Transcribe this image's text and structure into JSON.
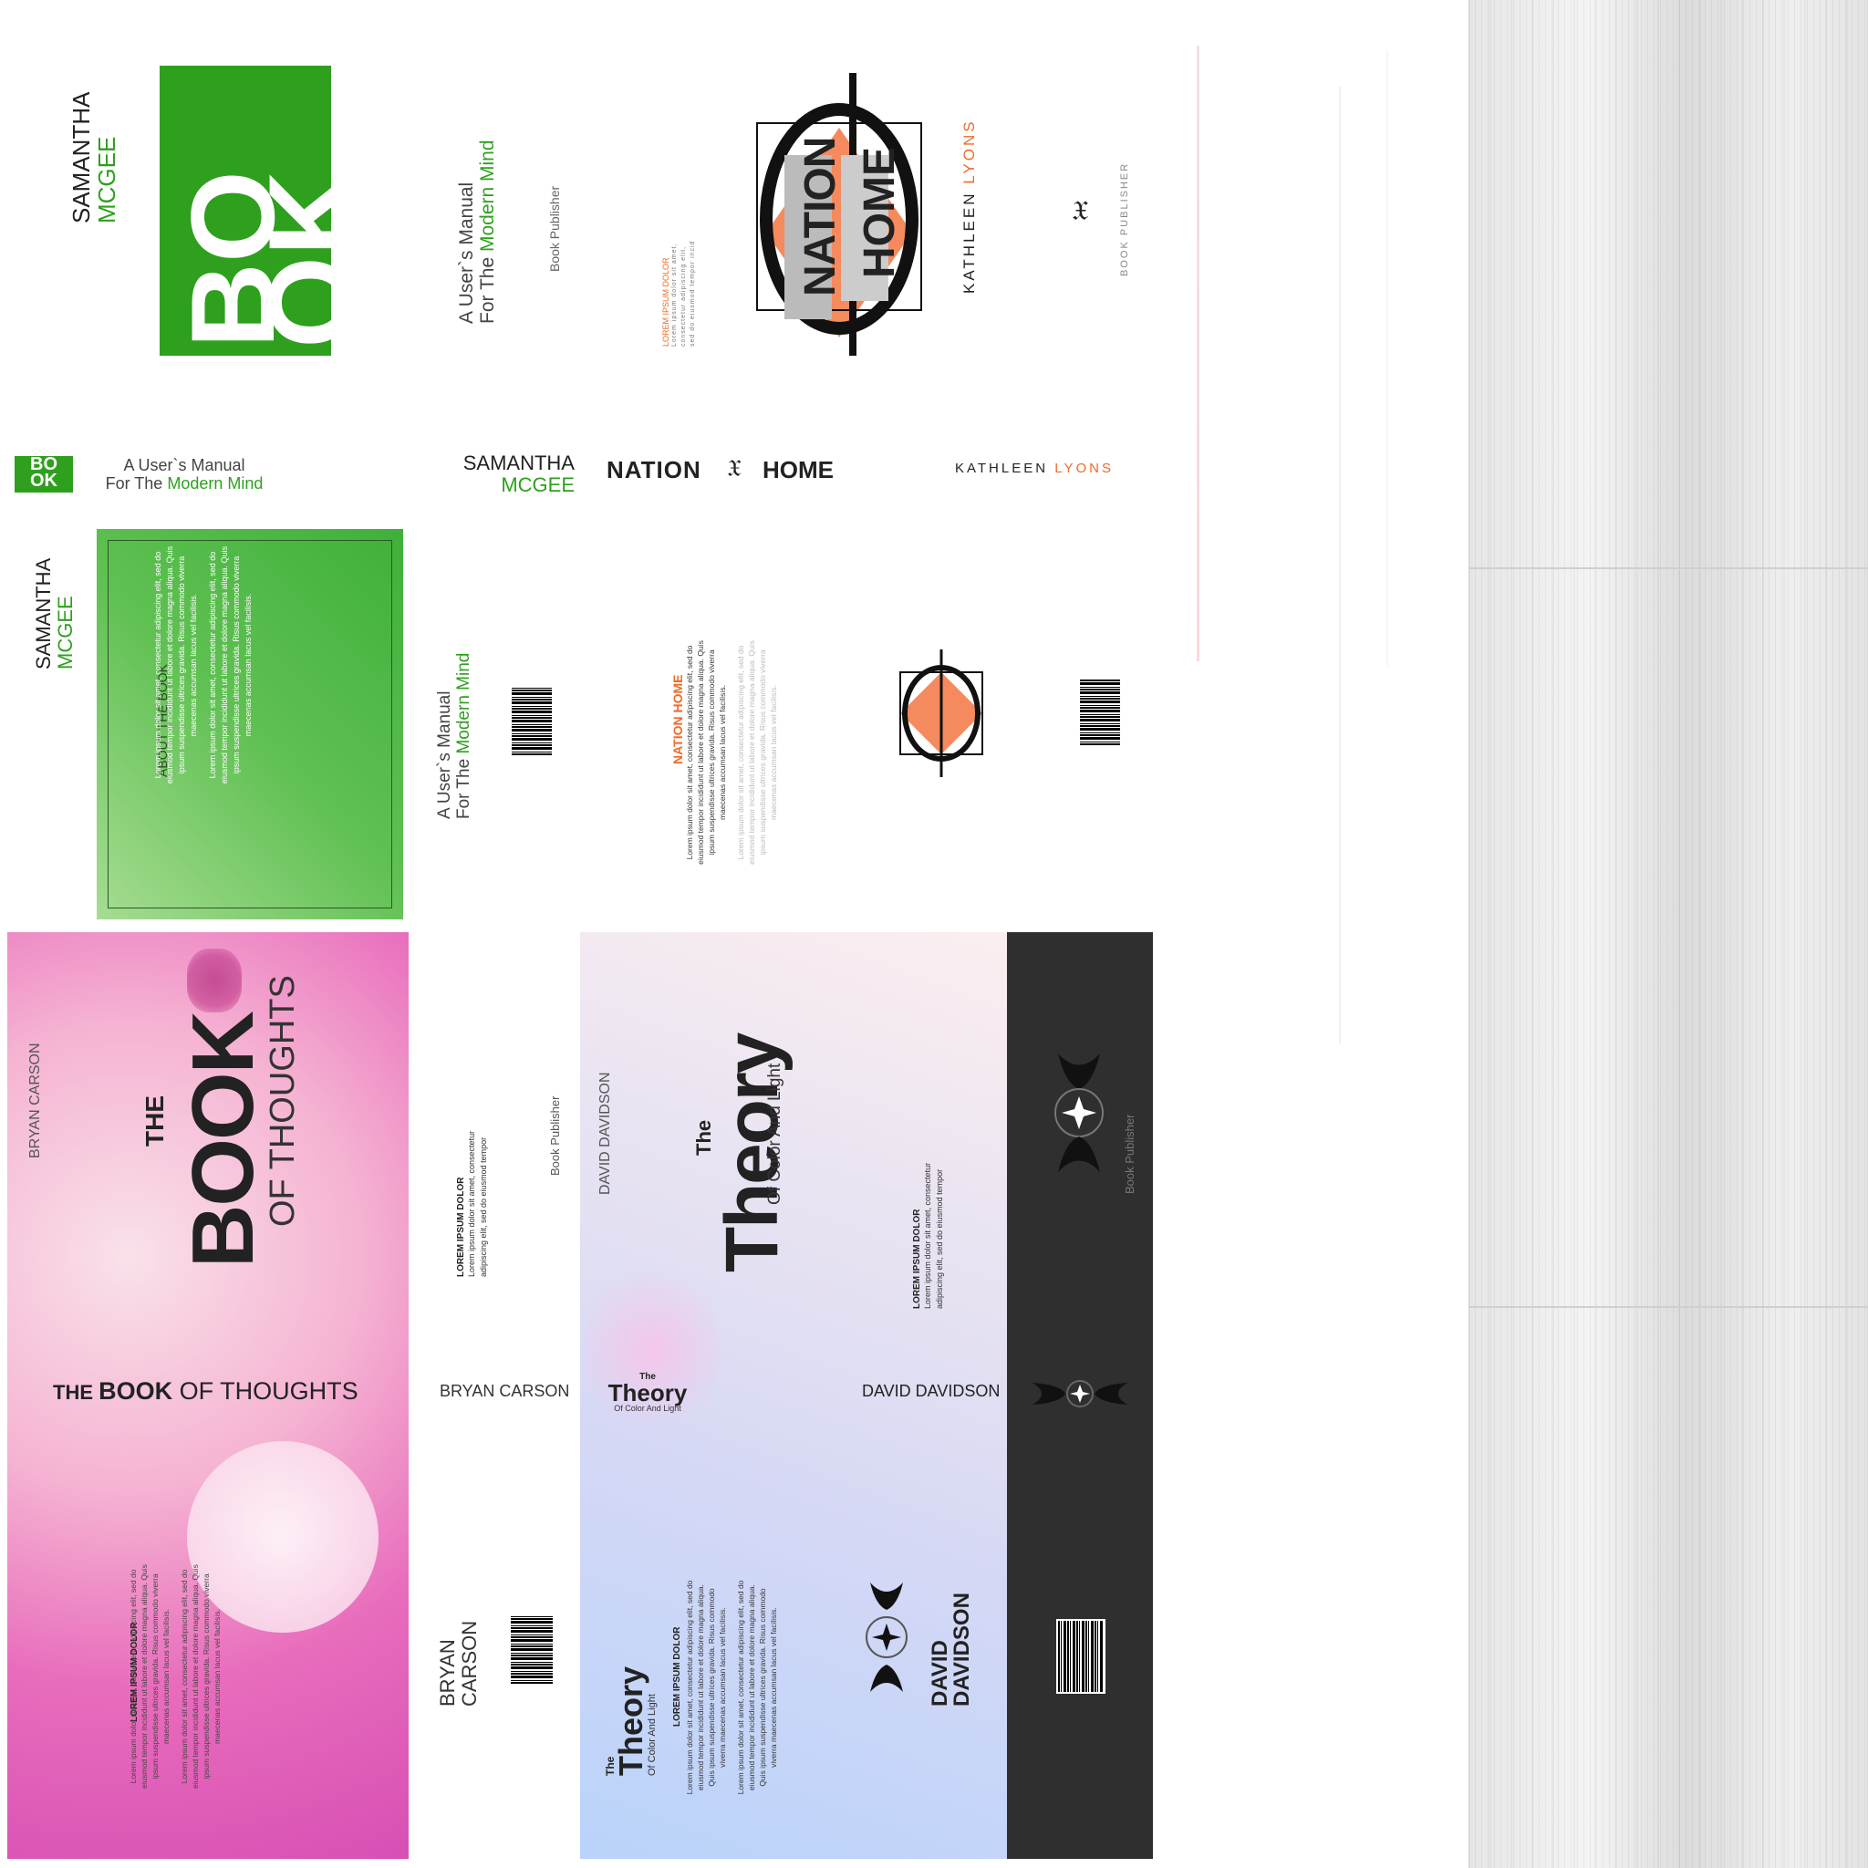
{
  "green_book": {
    "author_first": "SAMANTHA",
    "author_last": "MCGEE",
    "logo_top": "BO",
    "logo_bottom": "OK",
    "title_line1": "A User`s Manual",
    "title_line2_prefix": "For The ",
    "title_line2_accent": "Modern Mind",
    "publisher": "Book Publisher",
    "about_heading": "ABOUT THE BOOK",
    "about_p1": "Lorem ipsum dolor sit amet, consectetur adipiscing elit, sed do eiusmod tempor incididunt ut labore et dolore magna aliqua. Quis ipsum suspendisse ultrices gravida. Risus commodo viverra maecenas accumsan lacus vel facilisis.",
    "about_p2": "Lorem ipsum dolor sit amet, consectetur adipiscing elit, sed do eiusmod tempor incididunt ut labore et dolore magna aliqua. Quis ipsum suspendisse ultrices gravida. Risus commodo viverra maecenas accumsan lacus vel facilisis.",
    "accent": "#2ea01e"
  },
  "nation_book": {
    "title_word1": "NATION",
    "title_word2": "HOME",
    "author_first": "KATHLEEN",
    "author_last": "LYONS",
    "publisher": "BOOK PUBLISHER",
    "blurb_heading": "LOREM IPSUM DOLOR",
    "blurb_text": "Lorem ipsum dolor sit amet, consectetur adipiscing elit, sed do eiusmod tempor incid",
    "back_heading": "NATION HOME",
    "back_p1": "Lorem ipsum dolor sit amet, consectetur adipiscing elit, sed do eiusmod tempor incididunt ut labore et dolore magna aliqua. Quis ipsum suspendisse ultrices gravida. Risus commodo viverra maecenas accumsan lacus vel facilisis.",
    "back_p2": "Lorem ipsum dolor sit amet, consectetur adipiscing elit, sed do eiusmod tempor incididunt ut labore et dolore magna aliqua. Quis ipsum suspendisse ultrices gravida. Risus commodo viverra maecenas accumsan lacus vel facilisis.",
    "accent": "#f06a28"
  },
  "thoughts_book": {
    "author": "BRYAN CARSON",
    "author_first": "BRYAN",
    "author_last": "CARSON",
    "title_the": "THE",
    "title_book": "BOOK",
    "title_rest": "OF THOUGHTS",
    "spine_the": "THE ",
    "spine_book": "BOOK",
    "spine_rest": " OF THOUGHTS",
    "blurb_heading": "LOREM IPSUM DOLOR",
    "blurb_text": "Lorem ipsum dolor sit amet, consectetur adipiscing elit, sed do eiusmod tempor",
    "publisher": "Book Publisher",
    "back_p1": "Lorem ipsum dolor sit amet, consectetur adipiscing elit, sed do eiusmod tempor incididunt ut labore et dolore magna aliqua. Quis ipsum suspendisse ultrices gravida. Risus commodo viverra maecenas accumsan lacus vel facilisis.",
    "back_p2": "Lorem ipsum dolor sit amet, consectetur adipiscing elit, sed do eiusmod tempor incididunt ut labore et dolore magna aliqua. Quis ipsum suspendisse ultrices gravida. Risus commodo viverra maecenas accumsan lacus vel facilisis."
  },
  "theory_book": {
    "author": "DAVID DAVIDSON",
    "author_first": "DAVID",
    "author_last": "DAVIDSON",
    "title_the": "The",
    "title_main": "Theory",
    "title_sub": "Of Color And Light",
    "blurb_heading": "LOREM IPSUM DOLOR",
    "blurb_text": "Lorem ipsum dolor sit amet, consectetur adipiscing elit, sed do eiusmod tempor",
    "publisher": "Book Publisher",
    "back_p1": "Lorem ipsum dolor sit amet, consectetur adipiscing elit, sed do eiusmod tempor incididunt ut labore et dolore magna aliqua. Quis ipsum suspendisse ultrices gravida. Risus commodo viverra maecenas accumsan lacus vel facilisis.",
    "back_p2": "Lorem ipsum dolor sit amet, consectetur adipiscing elit, sed do eiusmod tempor incididunt ut labore et dolore magna aliqua. Quis ipsum suspendisse ultrices gravida. Risus commodo viverra maecenas accumsan lacus vel facilisis."
  }
}
